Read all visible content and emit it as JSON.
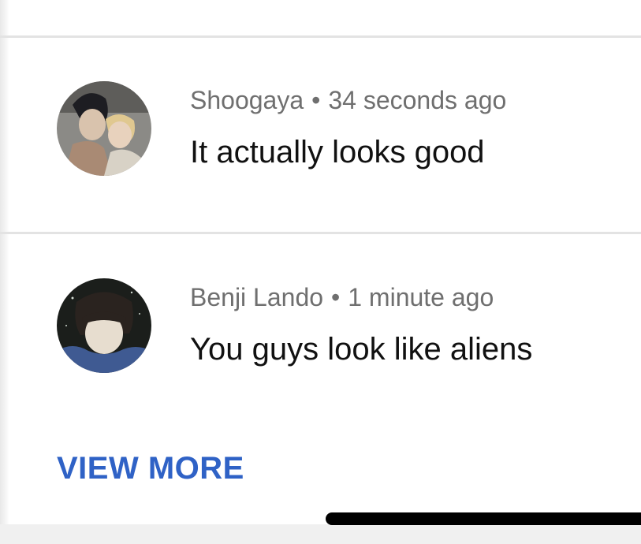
{
  "comments": [
    {
      "author": "Shoogaya",
      "separator": "•",
      "time": "34 seconds ago",
      "text": "It actually looks good",
      "avatar_icon": "anime-couple-avatar"
    },
    {
      "author": "Benji Lando",
      "separator": "•",
      "time": "1 minute ago",
      "text": "You guys look like aliens",
      "avatar_icon": "user-photo-avatar"
    }
  ],
  "actions": {
    "view_more_label": "VIEW MORE"
  },
  "colors": {
    "link": "#2f62c6",
    "meta": "#6f6f6f",
    "text": "#111111",
    "divider": "#e3e3e3"
  }
}
